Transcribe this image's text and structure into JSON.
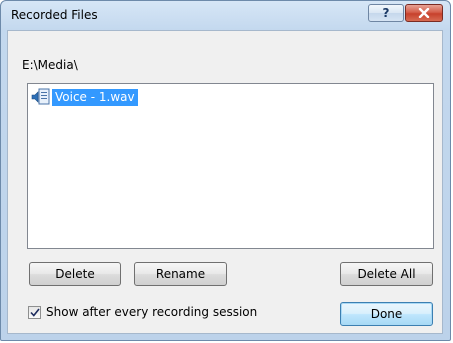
{
  "window": {
    "title": "Recorded Files",
    "help_button_label": "?"
  },
  "path": "E:\\Media\\",
  "file_list": {
    "items": [
      {
        "name": "Voice - 1.wav",
        "selected": true,
        "icon": "audio-file-icon"
      }
    ]
  },
  "buttons": {
    "delete": "Delete",
    "rename": "Rename",
    "delete_all": "Delete All",
    "done": "Done"
  },
  "options": {
    "show_after_session_label": "Show after every recording session",
    "show_after_session_checked": true
  },
  "colors": {
    "selection": "#3399ff",
    "close_button": "#c7412c",
    "title_bar": "#c3d8ee"
  }
}
